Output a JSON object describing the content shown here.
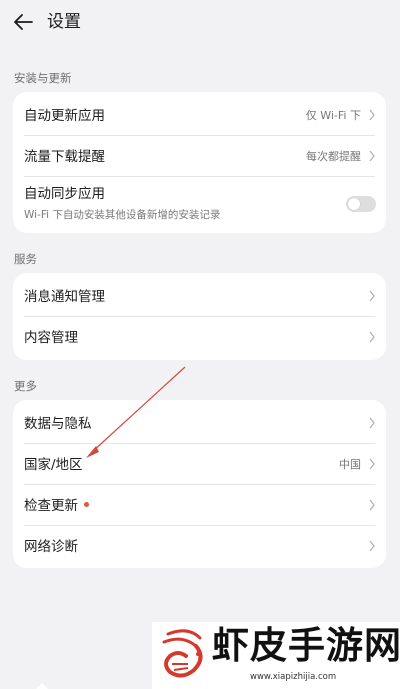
{
  "header": {
    "title": "设置",
    "back_icon": "arrow-left-icon"
  },
  "sections": [
    {
      "title": "安装与更新",
      "items": [
        {
          "label": "自动更新应用",
          "value": "仅 Wi-Fi 下",
          "control": "chevron"
        },
        {
          "label": "流量下载提醒",
          "value": "每次都提醒",
          "control": "chevron"
        },
        {
          "label": "自动同步应用",
          "subtitle": "Wi-Fi 下自动安装其他设备新增的安装记录",
          "control": "toggle",
          "toggle_on": false
        }
      ]
    },
    {
      "title": "服务",
      "items": [
        {
          "label": "消息通知管理",
          "control": "chevron"
        },
        {
          "label": "内容管理",
          "control": "chevron"
        }
      ]
    },
    {
      "title": "更多",
      "items": [
        {
          "label": "数据与隐私",
          "control": "chevron"
        },
        {
          "label": "国家/地区",
          "value": "中国",
          "control": "chevron"
        },
        {
          "label": "检查更新",
          "control": "chevron",
          "badge": "red-dot"
        },
        {
          "label": "网络诊断",
          "control": "chevron"
        }
      ]
    }
  ],
  "watermark": {
    "title": "虾皮手游网",
    "url": "www.xiapizhijia.com"
  },
  "colors": {
    "background": "#f2f2f4",
    "card": "#ffffff",
    "annotation_arrow": "#d0493a",
    "badge": "#e5533a"
  }
}
